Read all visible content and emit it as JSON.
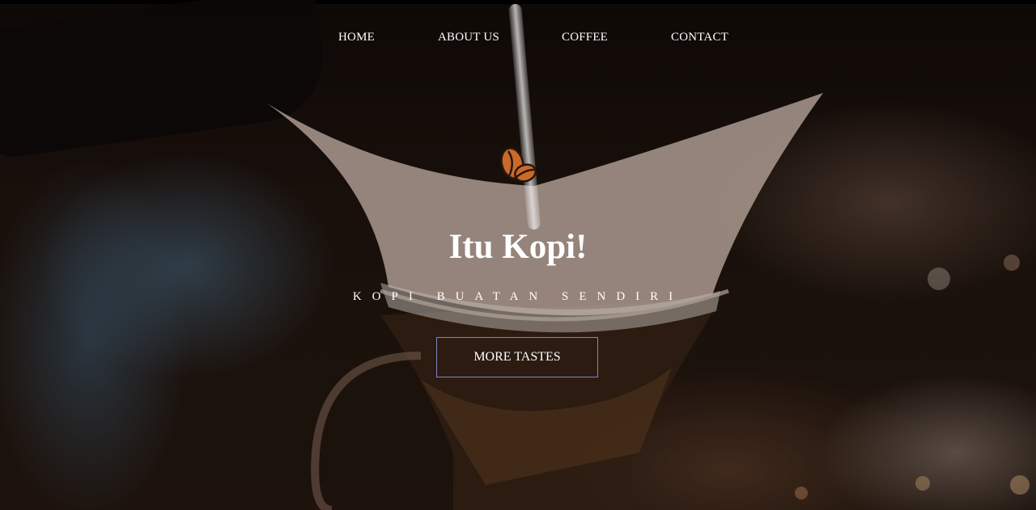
{
  "nav": {
    "items": [
      {
        "label": "HOME"
      },
      {
        "label": "ABOUT US"
      },
      {
        "label": "COFFEE"
      },
      {
        "label": "CONTACT"
      }
    ]
  },
  "hero": {
    "logo_icon": "coffee-beans-icon",
    "title": "Itu Kopi!",
    "subtitle": "KOPI BUATAN SENDIRI",
    "cta_label": "MORE TASTES"
  },
  "colors": {
    "text": "#ffffff",
    "button_border": "#7b86c9",
    "bean": "#c96a2b",
    "bean_outline": "#2a160c"
  }
}
